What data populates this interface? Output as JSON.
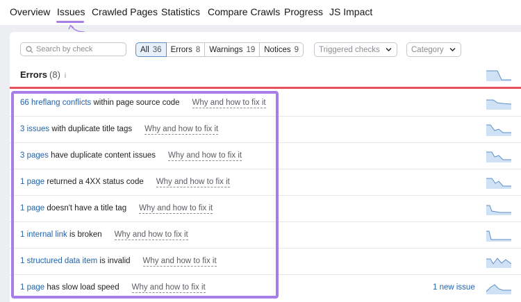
{
  "nav": {
    "tabs": [
      {
        "label": "Overview"
      },
      {
        "label": "Issues"
      },
      {
        "label": "Crawled Pages"
      },
      {
        "label": "Statistics"
      },
      {
        "label": "Compare Crawls"
      },
      {
        "label": "Progress"
      },
      {
        "label": "JS Impact"
      }
    ],
    "active": "Issues"
  },
  "filters": {
    "search_placeholder": "Search by check",
    "segments": [
      {
        "label": "All",
        "count": "36"
      },
      {
        "label": "Errors",
        "count": "8"
      },
      {
        "label": "Warnings",
        "count": "19"
      },
      {
        "label": "Notices",
        "count": "9"
      }
    ],
    "triggered_checks": "Triggered checks",
    "category": "Category"
  },
  "errors": {
    "title": "Errors",
    "count": "(8)",
    "info": "i",
    "rows": [
      {
        "link": "66 hreflang conflicts",
        "text": " within page source code",
        "why": "Why and how to fix it",
        "new": ""
      },
      {
        "link": "3 issues",
        "text": " with duplicate title tags",
        "why": "Why and how to fix it",
        "new": ""
      },
      {
        "link": "3 pages",
        "text": " have duplicate content issues",
        "why": "Why and how to fix it",
        "new": ""
      },
      {
        "link": "1 page",
        "text": " returned a 4XX status code",
        "why": "Why and how to fix it",
        "new": ""
      },
      {
        "link": "1 page",
        "text": " doesn't have a title tag",
        "why": "Why and how to fix it",
        "new": ""
      },
      {
        "link": "1 internal link",
        "text": " is broken",
        "why": "Why and how to fix it",
        "new": ""
      },
      {
        "link": "1 structured data item",
        "text": " is invalid",
        "why": "Why and how to fix it",
        "new": ""
      },
      {
        "link": "1 page",
        "text": " has slow load speed",
        "why": "Why and how to fix it",
        "new": "1 new issue"
      }
    ]
  },
  "colors": {
    "accent_purple": "#a77ee8",
    "error_red": "#e8505b",
    "link_blue": "#2563a8",
    "spark_fill": "#cfe2f5",
    "spark_line": "#5c8fc6"
  }
}
